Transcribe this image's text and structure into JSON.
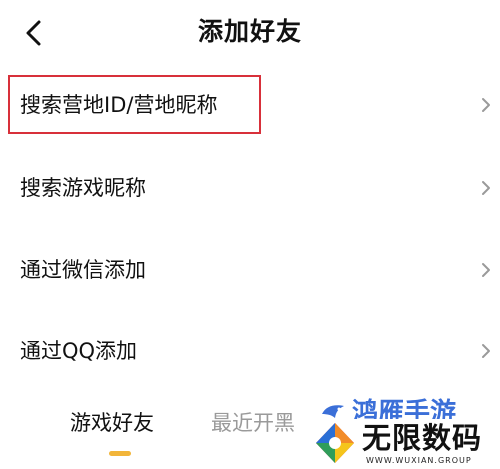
{
  "header": {
    "back_icon": "chevron-left-icon",
    "title": "添加好友"
  },
  "menu": {
    "items": [
      {
        "label": "搜索营地ID/营地昵称",
        "icon": "chevron-right-icon",
        "highlighted": true
      },
      {
        "label": "搜索游戏昵称",
        "icon": "chevron-right-icon"
      },
      {
        "label": "通过微信添加",
        "icon": "chevron-right-icon"
      },
      {
        "label": "通过QQ添加",
        "icon": "chevron-right-icon"
      }
    ]
  },
  "tabs": [
    {
      "label": "游戏好友",
      "active": true
    },
    {
      "label": "最近开黑",
      "active": false
    }
  ],
  "watermark": {
    "top_text": "鸿雁手游",
    "logo_text": "无限数码",
    "logo_sub": "WWW.WUXIAN.GROUP"
  },
  "colors": {
    "highlight_border": "#d8303a",
    "tab_indicator": "#f2b53a",
    "inactive_tab": "#9a9a9a",
    "watermark_blue": "#3b6fd8"
  }
}
